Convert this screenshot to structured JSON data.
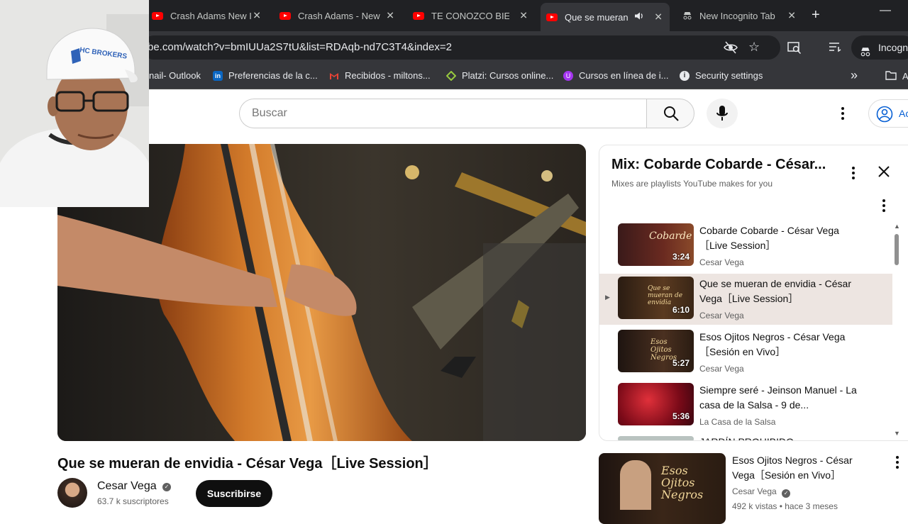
{
  "browser": {
    "tabs": [
      {
        "label": "Crash Adams New I",
        "icon": "youtube-icon",
        "active": false
      },
      {
        "label": "Crash Adams - New",
        "icon": "youtube-icon",
        "active": false
      },
      {
        "label": "TE CONOZCO BIEN",
        "icon": "youtube-icon",
        "active": false
      },
      {
        "label": "Que se mueran",
        "icon": "youtube-icon",
        "active": true,
        "audio": true
      },
      {
        "label": "New Incognito Tab",
        "icon": "incognito-icon",
        "active": false
      }
    ],
    "new_tab": "+",
    "url": "be.com/watch?v=bmIUUa2S7tU&list=RDAqb-nd7C3T4&index=2",
    "profile_label": "Incogni",
    "bookmarks": [
      {
        "label": "nail- Outlook",
        "icon": "outlook-icon"
      },
      {
        "label": "Preferencias de la c...",
        "icon": "linkedin-icon",
        "color": "#0a66c2"
      },
      {
        "label": "Recibidos - miltons...",
        "icon": "gmail-icon",
        "color": "#ea4335"
      },
      {
        "label": "Platzi: Cursos online...",
        "icon": "platzi-icon",
        "color": "#98ca3f"
      },
      {
        "label": "Cursos en línea de i...",
        "icon": "udemy-icon",
        "color": "#a435f0"
      },
      {
        "label": "Security settings",
        "icon": "info-icon",
        "color": "#e8eaed"
      }
    ],
    "bookmarks_more": "»",
    "bookmarks_folder_label": "A"
  },
  "youtube": {
    "search_placeholder": "Buscar",
    "signin_label": "Ac",
    "video": {
      "title": "Que se mueran de envidia - César Vega［Live Session］",
      "channel": "Cesar Vega",
      "verified_mark": "✓",
      "subscribers": "63.7 k suscriptores",
      "subscribe_label": "Suscribirse"
    },
    "playlist": {
      "title": "Mix: Cobarde Cobarde - César...",
      "subtitle": "Mixes are playlists YouTube makes for you",
      "items": [
        {
          "title": "Cobarde Cobarde - César Vega［Live Session］",
          "channel": "Cesar Vega",
          "duration": "3:24",
          "active": false,
          "thumb_text": "Cobarde"
        },
        {
          "title": "Que se mueran de envidia - César Vega［Live Session］",
          "channel": "Cesar Vega",
          "duration": "6:10",
          "active": true,
          "thumb_text": "Que se mueran de envidia"
        },
        {
          "title": "Esos Ojitos Negros - César Vega［Sesión en Vivo］",
          "channel": "Cesar Vega",
          "duration": "5:27",
          "active": false,
          "thumb_text": "Esos Ojitos Negros"
        },
        {
          "title": "Siempre seré - Jeinson Manuel - La casa de la Salsa - 9 de...",
          "channel": "La Casa de la Salsa",
          "duration": "5:36",
          "active": false,
          "thumb_text": ""
        }
      ],
      "partial_item": "JARDÍN PROHIBIDO"
    },
    "recommended": {
      "title": "Esos Ojitos Negros - César Vega［Sesión en Vivo］",
      "channel": "Cesar Vega",
      "meta": "492 k vistas • hace 3 meses",
      "thumb_text": "Esos Ojitos Negros"
    },
    "webcam_cap_text": "HC BROKERS"
  },
  "colors": {
    "chrome_dark": "#202124",
    "chrome_toolbar": "#35363a",
    "youtube_red": "#ff0000",
    "active_row": "#ede5e1"
  }
}
